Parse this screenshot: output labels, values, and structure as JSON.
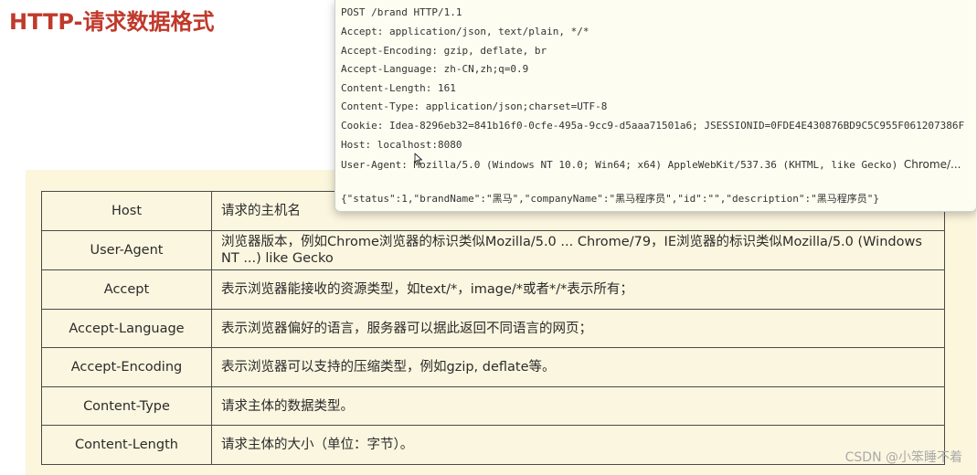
{
  "title": "HTTP-请求数据格式",
  "request_popup": {
    "lines": [
      "POST /brand HTTP/1.1",
      "Accept: application/json, text/plain, */*",
      "Accept-Encoding: gzip, deflate, br",
      "Accept-Language: zh-CN,zh;q=0.9",
      "Content-Length: 161",
      "Content-Type: application/json;charset=UTF-8",
      "Cookie: Idea-8296eb32=841b16f0-0cfe-495a-9cc9-d5aaa71501a6; JSESSIONID=0FDE4E430876BD9C5C955F061207386F",
      "Host: localhost:8080",
      "User-Agent: Mozilla/5.0 (Windows NT 10.0; Win64; x64) AppleWebKit/537.36 (KHTML, like Gecko)"
    ],
    "ua_tail": "Chrome/...",
    "body": "{\"status\":1,\"brandName\":\"黑马\",\"companyName\":\"黑马程序员\",\"id\":\"\",\"description\":\"黑马程序员\"}"
  },
  "header_table": {
    "rows": [
      {
        "name": "Host",
        "desc": "请求的主机名"
      },
      {
        "name": "User-Agent",
        "desc": "浏览器版本，例如Chrome浏览器的标识类似Mozilla/5.0 ... Chrome/79，IE浏览器的标识类似Mozilla/5.0 (Windows NT ...) like Gecko"
      },
      {
        "name": "Accept",
        "desc": "表示浏览器能接收的资源类型，如text/*，image/*或者*/*表示所有；"
      },
      {
        "name": "Accept-Language",
        "desc": "表示浏览器偏好的语言，服务器可以据此返回不同语言的网页；"
      },
      {
        "name": "Accept-Encoding",
        "desc": "表示浏览器可以支持的压缩类型，例如gzip, deflate等。"
      },
      {
        "name": "Content-Type",
        "desc": "请求主体的数据类型。"
      },
      {
        "name": "Content-Length",
        "desc": "请求主体的大小（单位：字节）。"
      }
    ]
  },
  "watermark": "CSDN @小笨睡不着"
}
